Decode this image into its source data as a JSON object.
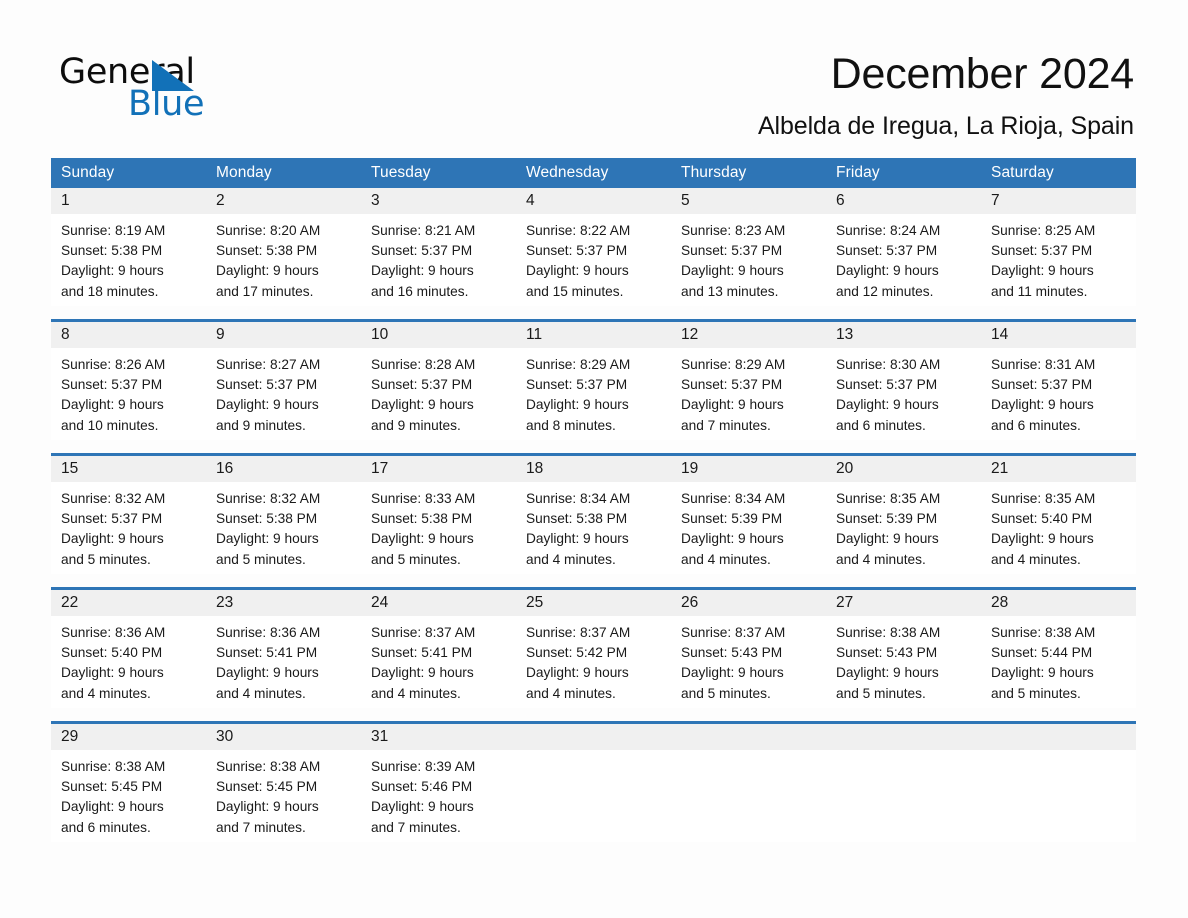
{
  "brand": {
    "name_part1": "General",
    "name_part2": "Blue",
    "triangle_color": "#1271b8"
  },
  "header": {
    "month_title": "December 2024",
    "location": "Albelda de Iregua, La Rioja, Spain"
  },
  "colors": {
    "header_blue": "#2e75b6",
    "daynum_band": "#f0f0f0",
    "page_background": "#fdfdfd",
    "text": "#1a1a1a"
  },
  "weekdays": [
    "Sunday",
    "Monday",
    "Tuesday",
    "Wednesday",
    "Thursday",
    "Friday",
    "Saturday"
  ],
  "weeks": [
    {
      "days": [
        {
          "number": "1",
          "sunrise": "Sunrise: 8:19 AM",
          "sunset": "Sunset: 5:38 PM",
          "daylight_line1": "Daylight: 9 hours",
          "daylight_line2": "and 18 minutes."
        },
        {
          "number": "2",
          "sunrise": "Sunrise: 8:20 AM",
          "sunset": "Sunset: 5:38 PM",
          "daylight_line1": "Daylight: 9 hours",
          "daylight_line2": "and 17 minutes."
        },
        {
          "number": "3",
          "sunrise": "Sunrise: 8:21 AM",
          "sunset": "Sunset: 5:37 PM",
          "daylight_line1": "Daylight: 9 hours",
          "daylight_line2": "and 16 minutes."
        },
        {
          "number": "4",
          "sunrise": "Sunrise: 8:22 AM",
          "sunset": "Sunset: 5:37 PM",
          "daylight_line1": "Daylight: 9 hours",
          "daylight_line2": "and 15 minutes."
        },
        {
          "number": "5",
          "sunrise": "Sunrise: 8:23 AM",
          "sunset": "Sunset: 5:37 PM",
          "daylight_line1": "Daylight: 9 hours",
          "daylight_line2": "and 13 minutes."
        },
        {
          "number": "6",
          "sunrise": "Sunrise: 8:24 AM",
          "sunset": "Sunset: 5:37 PM",
          "daylight_line1": "Daylight: 9 hours",
          "daylight_line2": "and 12 minutes."
        },
        {
          "number": "7",
          "sunrise": "Sunrise: 8:25 AM",
          "sunset": "Sunset: 5:37 PM",
          "daylight_line1": "Daylight: 9 hours",
          "daylight_line2": "and 11 minutes."
        }
      ]
    },
    {
      "days": [
        {
          "number": "8",
          "sunrise": "Sunrise: 8:26 AM",
          "sunset": "Sunset: 5:37 PM",
          "daylight_line1": "Daylight: 9 hours",
          "daylight_line2": "and 10 minutes."
        },
        {
          "number": "9",
          "sunrise": "Sunrise: 8:27 AM",
          "sunset": "Sunset: 5:37 PM",
          "daylight_line1": "Daylight: 9 hours",
          "daylight_line2": "and 9 minutes."
        },
        {
          "number": "10",
          "sunrise": "Sunrise: 8:28 AM",
          "sunset": "Sunset: 5:37 PM",
          "daylight_line1": "Daylight: 9 hours",
          "daylight_line2": "and 9 minutes."
        },
        {
          "number": "11",
          "sunrise": "Sunrise: 8:29 AM",
          "sunset": "Sunset: 5:37 PM",
          "daylight_line1": "Daylight: 9 hours",
          "daylight_line2": "and 8 minutes."
        },
        {
          "number": "12",
          "sunrise": "Sunrise: 8:29 AM",
          "sunset": "Sunset: 5:37 PM",
          "daylight_line1": "Daylight: 9 hours",
          "daylight_line2": "and 7 minutes."
        },
        {
          "number": "13",
          "sunrise": "Sunrise: 8:30 AM",
          "sunset": "Sunset: 5:37 PM",
          "daylight_line1": "Daylight: 9 hours",
          "daylight_line2": "and 6 minutes."
        },
        {
          "number": "14",
          "sunrise": "Sunrise: 8:31 AM",
          "sunset": "Sunset: 5:37 PM",
          "daylight_line1": "Daylight: 9 hours",
          "daylight_line2": "and 6 minutes."
        }
      ]
    },
    {
      "days": [
        {
          "number": "15",
          "sunrise": "Sunrise: 8:32 AM",
          "sunset": "Sunset: 5:37 PM",
          "daylight_line1": "Daylight: 9 hours",
          "daylight_line2": "and 5 minutes."
        },
        {
          "number": "16",
          "sunrise": "Sunrise: 8:32 AM",
          "sunset": "Sunset: 5:38 PM",
          "daylight_line1": "Daylight: 9 hours",
          "daylight_line2": "and 5 minutes."
        },
        {
          "number": "17",
          "sunrise": "Sunrise: 8:33 AM",
          "sunset": "Sunset: 5:38 PM",
          "daylight_line1": "Daylight: 9 hours",
          "daylight_line2": "and 5 minutes."
        },
        {
          "number": "18",
          "sunrise": "Sunrise: 8:34 AM",
          "sunset": "Sunset: 5:38 PM",
          "daylight_line1": "Daylight: 9 hours",
          "daylight_line2": "and 4 minutes."
        },
        {
          "number": "19",
          "sunrise": "Sunrise: 8:34 AM",
          "sunset": "Sunset: 5:39 PM",
          "daylight_line1": "Daylight: 9 hours",
          "daylight_line2": "and 4 minutes."
        },
        {
          "number": "20",
          "sunrise": "Sunrise: 8:35 AM",
          "sunset": "Sunset: 5:39 PM",
          "daylight_line1": "Daylight: 9 hours",
          "daylight_line2": "and 4 minutes."
        },
        {
          "number": "21",
          "sunrise": "Sunrise: 8:35 AM",
          "sunset": "Sunset: 5:40 PM",
          "daylight_line1": "Daylight: 9 hours",
          "daylight_line2": "and 4 minutes."
        }
      ]
    },
    {
      "days": [
        {
          "number": "22",
          "sunrise": "Sunrise: 8:36 AM",
          "sunset": "Sunset: 5:40 PM",
          "daylight_line1": "Daylight: 9 hours",
          "daylight_line2": "and 4 minutes."
        },
        {
          "number": "23",
          "sunrise": "Sunrise: 8:36 AM",
          "sunset": "Sunset: 5:41 PM",
          "daylight_line1": "Daylight: 9 hours",
          "daylight_line2": "and 4 minutes."
        },
        {
          "number": "24",
          "sunrise": "Sunrise: 8:37 AM",
          "sunset": "Sunset: 5:41 PM",
          "daylight_line1": "Daylight: 9 hours",
          "daylight_line2": "and 4 minutes."
        },
        {
          "number": "25",
          "sunrise": "Sunrise: 8:37 AM",
          "sunset": "Sunset: 5:42 PM",
          "daylight_line1": "Daylight: 9 hours",
          "daylight_line2": "and 4 minutes."
        },
        {
          "number": "26",
          "sunrise": "Sunrise: 8:37 AM",
          "sunset": "Sunset: 5:43 PM",
          "daylight_line1": "Daylight: 9 hours",
          "daylight_line2": "and 5 minutes."
        },
        {
          "number": "27",
          "sunrise": "Sunrise: 8:38 AM",
          "sunset": "Sunset: 5:43 PM",
          "daylight_line1": "Daylight: 9 hours",
          "daylight_line2": "and 5 minutes."
        },
        {
          "number": "28",
          "sunrise": "Sunrise: 8:38 AM",
          "sunset": "Sunset: 5:44 PM",
          "daylight_line1": "Daylight: 9 hours",
          "daylight_line2": "and 5 minutes."
        }
      ]
    },
    {
      "days": [
        {
          "number": "29",
          "sunrise": "Sunrise: 8:38 AM",
          "sunset": "Sunset: 5:45 PM",
          "daylight_line1": "Daylight: 9 hours",
          "daylight_line2": "and 6 minutes."
        },
        {
          "number": "30",
          "sunrise": "Sunrise: 8:38 AM",
          "sunset": "Sunset: 5:45 PM",
          "daylight_line1": "Daylight: 9 hours",
          "daylight_line2": "and 7 minutes."
        },
        {
          "number": "31",
          "sunrise": "Sunrise: 8:39 AM",
          "sunset": "Sunset: 5:46 PM",
          "daylight_line1": "Daylight: 9 hours",
          "daylight_line2": "and 7 minutes."
        },
        {
          "number": "",
          "sunrise": "",
          "sunset": "",
          "daylight_line1": "",
          "daylight_line2": ""
        },
        {
          "number": "",
          "sunrise": "",
          "sunset": "",
          "daylight_line1": "",
          "daylight_line2": ""
        },
        {
          "number": "",
          "sunrise": "",
          "sunset": "",
          "daylight_line1": "",
          "daylight_line2": ""
        },
        {
          "number": "",
          "sunrise": "",
          "sunset": "",
          "daylight_line1": "",
          "daylight_line2": ""
        }
      ]
    }
  ]
}
